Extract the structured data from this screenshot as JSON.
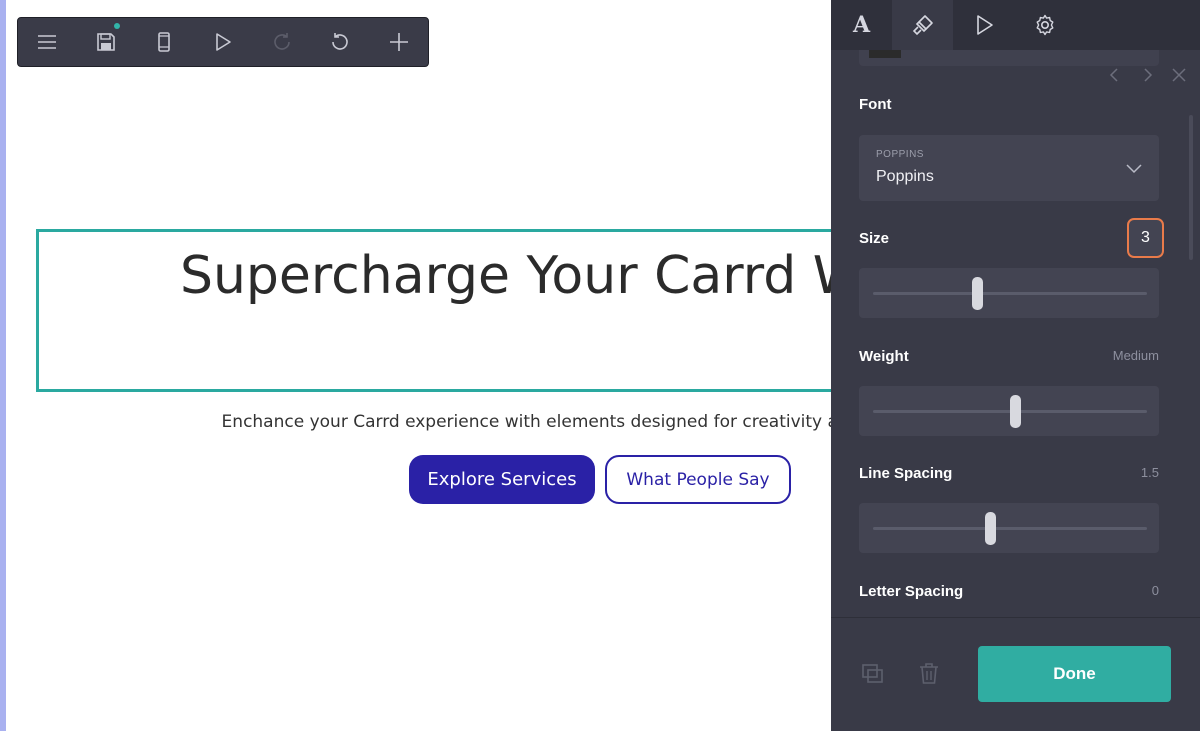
{
  "toolbar": {
    "items": [
      {
        "icon": "menu-icon"
      },
      {
        "icon": "save-icon",
        "unsaved_indicator": true
      },
      {
        "icon": "mobile-preview-icon"
      },
      {
        "icon": "play-icon"
      },
      {
        "icon": "redo-icon",
        "disabled": true
      },
      {
        "icon": "undo-icon"
      },
      {
        "icon": "add-icon"
      }
    ]
  },
  "canvas": {
    "headline": "Supercharge Your Carrd Website",
    "subtext": "Enchance your Carrd experience with elements designed for creativity and engagement.",
    "primary_button": "Explore Services",
    "secondary_button": "What People Say"
  },
  "panel": {
    "tabs": [
      {
        "icon": "text-icon",
        "label": "A",
        "active": false
      },
      {
        "icon": "style-brush-icon",
        "active": true
      },
      {
        "icon": "animation-play-icon",
        "active": false
      },
      {
        "icon": "settings-gear-icon",
        "active": false
      }
    ],
    "font": {
      "label": "Font",
      "select_caption": "POPPINS",
      "select_value": "Poppins"
    },
    "size": {
      "label": "Size",
      "input_value": "3",
      "slider_fraction": 0.38
    },
    "weight": {
      "label": "Weight",
      "value": "Medium",
      "slider_fraction": 0.52
    },
    "line_spacing": {
      "label": "Line Spacing",
      "value": "1.5",
      "slider_fraction": 0.43
    },
    "letter_spacing": {
      "label": "Letter Spacing",
      "value": "0"
    },
    "done_label": "Done"
  },
  "colors": {
    "accent_teal": "#30ada2",
    "primary_button": "#2a21a6",
    "panel_bg": "#393a47",
    "focus_outline": "#e97b4a"
  }
}
